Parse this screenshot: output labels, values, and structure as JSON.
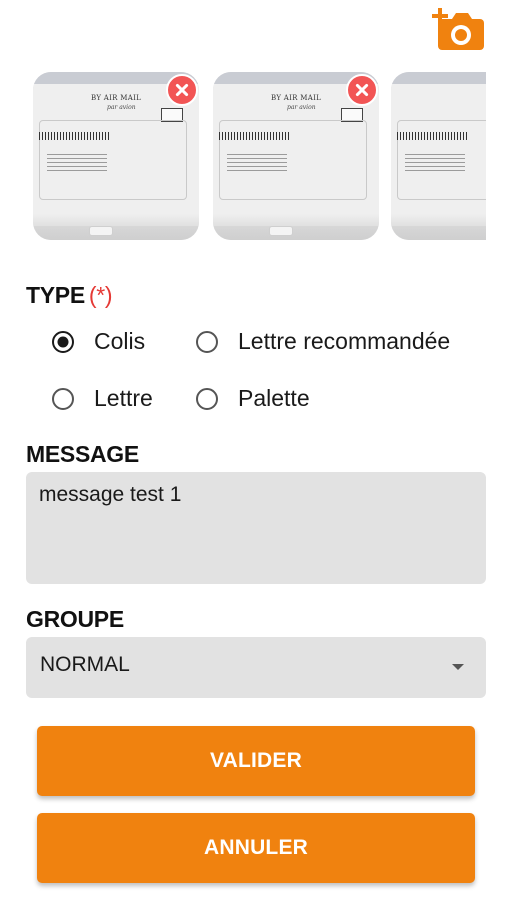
{
  "colors": {
    "accent": "#f0820f",
    "remove": "#f25555",
    "required": "#e53935",
    "field_background": "#e2e2e2"
  },
  "toolbar": {
    "add_photo_icon": "camera-plus-icon"
  },
  "photos": [
    {
      "airmail_text": "BY AIR MAIL",
      "airmail_subtext": "par avion",
      "remove_icon": "close-icon"
    },
    {
      "airmail_text": "BY AIR MAIL",
      "airmail_subtext": "par avion",
      "remove_icon": "close-icon"
    },
    {
      "airmail_text": "",
      "airmail_subtext": "",
      "remove_icon": ""
    }
  ],
  "type_section": {
    "label": "TYPE",
    "required_marker": "(*)",
    "options": [
      {
        "label": "Colis",
        "checked": true
      },
      {
        "label": "Lettre recommandée",
        "checked": false
      },
      {
        "label": "Lettre",
        "checked": false
      },
      {
        "label": "Palette",
        "checked": false
      }
    ]
  },
  "message_section": {
    "label": "MESSAGE",
    "value": "message test 1"
  },
  "groupe_section": {
    "label": "GROUPE",
    "selected": "NORMAL"
  },
  "actions": {
    "validate_label": "VALIDER",
    "cancel_label": "ANNULER"
  }
}
